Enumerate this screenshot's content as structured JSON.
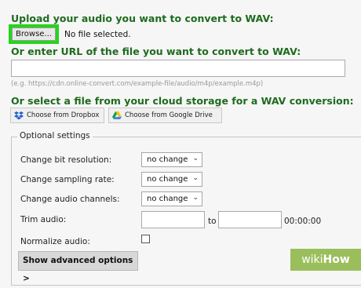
{
  "upload": {
    "heading": "Upload your audio you want to convert to WAV:",
    "browse_label": "Browse...",
    "file_status": "No file selected."
  },
  "url": {
    "heading": "Or enter URL of the file you want to convert to WAV:",
    "value": "",
    "hint": "(e.g. https://cdn.online-convert.com/example-file/audio/m4p/example.m4p)"
  },
  "cloud": {
    "heading": "Or select a file from your cloud storage for a WAV conversion:",
    "dropbox_label": "Choose from Dropbox",
    "dropbox_icon": "dropbox-icon",
    "gdrive_label": "Choose from Google Drive",
    "gdrive_icon": "google-drive-icon"
  },
  "optional": {
    "legend": "Optional settings",
    "bit_resolution": {
      "label": "Change bit resolution:",
      "value": "no change"
    },
    "sampling_rate": {
      "label": "Change sampling rate:",
      "value": "no change"
    },
    "audio_channels": {
      "label": "Change audio channels:",
      "value": "no change"
    },
    "trim": {
      "label": "Trim audio:",
      "to_label": "to",
      "end_time": "00:00:00"
    },
    "normalize": {
      "label": "Normalize audio:",
      "checked": false
    },
    "advanced_button": "Show advanced options >"
  },
  "watermark": {
    "prefix": "wiki",
    "suffix": "How"
  },
  "colors": {
    "heading_green": "#1e6b1e",
    "highlight_green": "#25d51b",
    "watermark_green": "#9bbe5c"
  }
}
